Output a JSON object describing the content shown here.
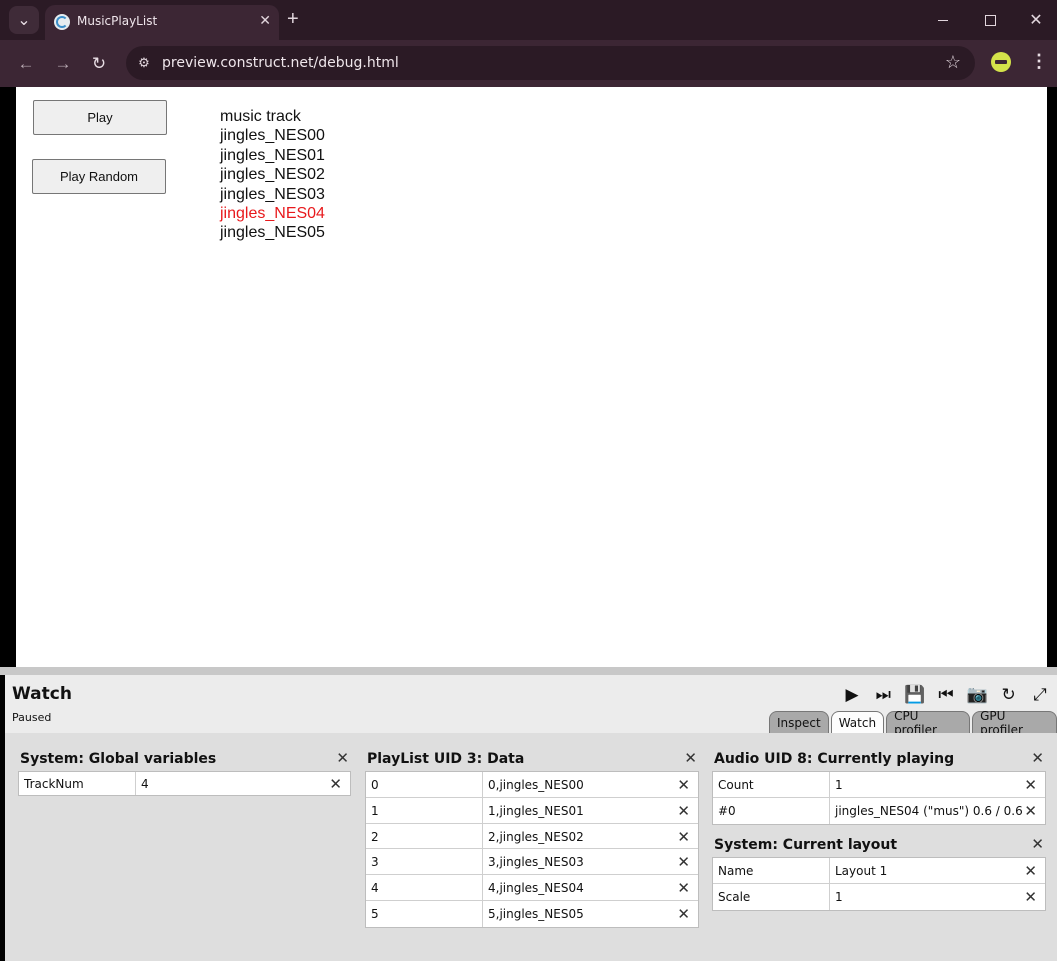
{
  "browser": {
    "tab_title": "MusicPlayList",
    "url": "preview.construct.net/debug.html",
    "icons": [
      "tab-list-icon",
      "construct-favicon",
      "close-icon",
      "plus-icon",
      "minimize-icon",
      "maximize-icon",
      "close-window-icon",
      "back-icon",
      "forward-icon",
      "reload-icon",
      "site-info-icon",
      "star-icon",
      "extension-icon",
      "more-icon"
    ],
    "glyphs": {
      "tab_menu": "⌄",
      "tab_close": "✕",
      "new_tab": "+",
      "win_close": "✕",
      "back": "←",
      "forward": "→",
      "reload": "↻",
      "site_info": "⚙",
      "star": "☆",
      "more": "⋮"
    }
  },
  "game": {
    "play_label": "Play",
    "play_random_label": "Play Random",
    "list_header": "music track",
    "tracks": [
      "jingles_NES00",
      "jingles_NES01",
      "jingles_NES02",
      "jingles_NES03",
      "jingles_NES04",
      "jingles_NES05"
    ],
    "highlighted_track_index": 4,
    "highlight_color": "#e8191c"
  },
  "debugger": {
    "title": "Watch",
    "status": "Paused",
    "tool_glyphs": [
      "▶",
      "⏭",
      "💾",
      "⏮",
      "📷",
      "↻",
      "⤢"
    ],
    "tool_icons": [
      "play-icon",
      "step-icon",
      "save-icon",
      "restart-icon",
      "camera-icon",
      "reload-icon",
      "popout-icon"
    ],
    "remove_glyph": "✕",
    "tabs": [
      {
        "label": "Inspect",
        "active": false
      },
      {
        "label": "Watch",
        "active": true
      },
      {
        "label": "CPU profiler",
        "active": false
      },
      {
        "label": "GPU profiler",
        "active": false
      }
    ],
    "sections": {
      "global": {
        "title": "System: Global variables",
        "rows": [
          {
            "key": "TrackNum",
            "value": "4"
          }
        ]
      },
      "playlist": {
        "title": "PlayList UID 3: Data",
        "rows": [
          {
            "key": "0",
            "value": "0,jingles_NES00"
          },
          {
            "key": "1",
            "value": "1,jingles_NES01"
          },
          {
            "key": "2",
            "value": "2,jingles_NES02"
          },
          {
            "key": "3",
            "value": "3,jingles_NES03"
          },
          {
            "key": "4",
            "value": "4,jingles_NES04"
          },
          {
            "key": "5",
            "value": "5,jingles_NES05"
          }
        ]
      },
      "audio": {
        "title": "Audio UID 8: Currently playing",
        "rows": [
          {
            "key": "Count",
            "value": "1"
          },
          {
            "key": "#0",
            "value": "jingles_NES04 (\"mus\") 0.6 / 0.6"
          }
        ]
      },
      "layout": {
        "title": "System: Current layout",
        "rows": [
          {
            "key": "Name",
            "value": "Layout 1"
          },
          {
            "key": "Scale",
            "value": "1"
          }
        ]
      }
    }
  }
}
